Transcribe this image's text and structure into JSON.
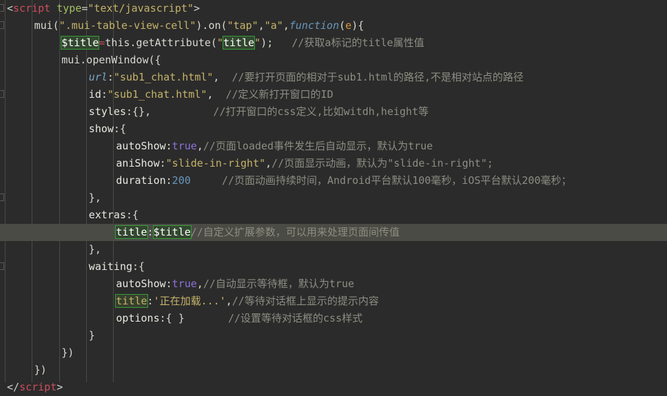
{
  "editor": {
    "name": "code-editor",
    "language": "html-javascript",
    "theme": "darcula",
    "colors": {
      "background": "#2b2b2b",
      "current_line": "#4b4b45",
      "indent_guide": "#4a4a48",
      "tag": "#cc4e5c",
      "attribute": "#a5c261",
      "string": "#c5b36a",
      "comment": "#8d8d83",
      "boolean": "#8d72d9",
      "number": "#6897bb",
      "keyword_function": "#6897bb",
      "parameter": "#d9963f",
      "field": "#7ba7c7",
      "search_highlight_border": "#3a9c3a",
      "search_highlight_fill": "#32472f",
      "default_text": "#d8d8d2"
    },
    "search_term": "title",
    "highlighted_line_index": 12,
    "fold_marker_lines": [
      0,
      1,
      5,
      11,
      15
    ],
    "indent_guide_x": [
      7,
      46,
      86,
      125,
      164
    ],
    "lines": [
      {
        "index": 0,
        "indent": 0,
        "tokens": [
          {
            "t": "<",
            "c": "punct"
          },
          {
            "t": "script",
            "c": "tag"
          },
          {
            "t": " ",
            "c": "plain"
          },
          {
            "t": "type",
            "c": "attr"
          },
          {
            "t": "=",
            "c": "punct"
          },
          {
            "t": "\"text/javascript\"",
            "c": "str"
          },
          {
            "t": ">",
            "c": "punct"
          }
        ]
      },
      {
        "index": 1,
        "indent": 1,
        "tokens": [
          {
            "t": "mui(",
            "c": "plain"
          },
          {
            "t": "\".mui-table-view-cell\"",
            "c": "str"
          },
          {
            "t": ").on(",
            "c": "plain"
          },
          {
            "t": "\"tap\"",
            "c": "str"
          },
          {
            "t": ",",
            "c": "plain"
          },
          {
            "t": "\"a\"",
            "c": "str"
          },
          {
            "t": ",",
            "c": "plain"
          },
          {
            "t": "function",
            "c": "kw-fn"
          },
          {
            "t": "(",
            "c": "plain"
          },
          {
            "t": "e",
            "c": "param"
          },
          {
            "t": "){",
            "c": "plain"
          }
        ]
      },
      {
        "index": 2,
        "indent": 2,
        "tokens": [
          {
            "t": "$title",
            "c": "plain",
            "hit": true
          },
          {
            "t": "=",
            "c": "op"
          },
          {
            "t": "this.getAttribute(",
            "c": "plain"
          },
          {
            "t": "\"",
            "c": "str"
          },
          {
            "t": "title",
            "c": "str",
            "hit": true
          },
          {
            "t": "\"",
            "c": "str"
          },
          {
            "t": ");",
            "c": "plain"
          },
          {
            "t": "   ",
            "c": "plain"
          },
          {
            "t": "//获取a标记的title属性值",
            "c": "comment"
          }
        ]
      },
      {
        "index": 3,
        "indent": 2,
        "tokens": [
          {
            "t": "mui.openWindow({",
            "c": "plain"
          }
        ]
      },
      {
        "index": 4,
        "indent": 3,
        "tokens": [
          {
            "t": "url",
            "c": "field"
          },
          {
            "t": ":",
            "c": "plain"
          },
          {
            "t": "\"sub1_chat.html\"",
            "c": "str"
          },
          {
            "t": ",  ",
            "c": "plain"
          },
          {
            "t": "//要打开页面的相对于sub1.html的路径,不是相对站点的路径",
            "c": "comment"
          }
        ]
      },
      {
        "index": 5,
        "indent": 3,
        "tokens": [
          {
            "t": "id",
            "c": "prop"
          },
          {
            "t": ":",
            "c": "plain"
          },
          {
            "t": "\"sub1_chat.html\"",
            "c": "str"
          },
          {
            "t": ",  ",
            "c": "plain"
          },
          {
            "t": "//定义新打开窗口的ID",
            "c": "comment"
          }
        ]
      },
      {
        "index": 6,
        "indent": 3,
        "tokens": [
          {
            "t": "styles",
            "c": "prop"
          },
          {
            "t": ":{},",
            "c": "plain"
          },
          {
            "t": "          ",
            "c": "plain"
          },
          {
            "t": "//打开窗口的css定义,比如witdh,height等",
            "c": "comment"
          }
        ]
      },
      {
        "index": 7,
        "indent": 3,
        "tokens": [
          {
            "t": "show",
            "c": "prop"
          },
          {
            "t": ":{",
            "c": "plain"
          }
        ]
      },
      {
        "index": 8,
        "indent": 4,
        "tokens": [
          {
            "t": "autoShow",
            "c": "prop"
          },
          {
            "t": ":",
            "c": "plain"
          },
          {
            "t": "true",
            "c": "bool"
          },
          {
            "t": ",",
            "c": "plain"
          },
          {
            "t": "//页面loaded事件发生后自动显示，默认为true",
            "c": "comment"
          }
        ]
      },
      {
        "index": 9,
        "indent": 4,
        "tokens": [
          {
            "t": "aniShow",
            "c": "prop"
          },
          {
            "t": ":",
            "c": "plain"
          },
          {
            "t": "\"slide-in-right\"",
            "c": "str"
          },
          {
            "t": ",",
            "c": "plain"
          },
          {
            "t": "//页面显示动画，默认为\"slide-in-right\";",
            "c": "comment"
          }
        ]
      },
      {
        "index": 10,
        "indent": 4,
        "tokens": [
          {
            "t": "duration",
            "c": "prop"
          },
          {
            "t": ":",
            "c": "plain"
          },
          {
            "t": "200",
            "c": "num"
          },
          {
            "t": "     ",
            "c": "plain"
          },
          {
            "t": "//页面动画持续时间，Android平台默认100毫秒，iOS平台默认200毫秒；",
            "c": "comment"
          }
        ]
      },
      {
        "index": 11,
        "indent": 3,
        "tokens": [
          {
            "t": "},",
            "c": "plain"
          }
        ]
      },
      {
        "index": 12,
        "indent": 3,
        "tokens": [
          {
            "t": "extras",
            "c": "prop"
          },
          {
            "t": ":{",
            "c": "plain"
          }
        ]
      },
      {
        "index": 13,
        "indent": 4,
        "highlighted": true,
        "tokens": [
          {
            "t": "title",
            "c": "plain",
            "hit": true
          },
          {
            "t": ":",
            "c": "plain"
          },
          {
            "t": "$title",
            "c": "plain",
            "hit": true
          },
          {
            "t": "//自定义扩展参数，可以用来处理页面间传值",
            "c": "comment"
          }
        ]
      },
      {
        "index": 14,
        "indent": 3,
        "tokens": [
          {
            "t": "},",
            "c": "plain"
          }
        ]
      },
      {
        "index": 15,
        "indent": 3,
        "tokens": [
          {
            "t": "waiting",
            "c": "prop"
          },
          {
            "t": ":{",
            "c": "plain"
          }
        ]
      },
      {
        "index": 16,
        "indent": 4,
        "tokens": [
          {
            "t": "autoShow",
            "c": "prop"
          },
          {
            "t": ":",
            "c": "plain"
          },
          {
            "t": "true",
            "c": "bool"
          },
          {
            "t": ",",
            "c": "plain"
          },
          {
            "t": "//自动显示等待框，默认为true",
            "c": "comment"
          }
        ]
      },
      {
        "index": 17,
        "indent": 4,
        "tokens": [
          {
            "t": "title",
            "c": "str",
            "hitdim": true
          },
          {
            "t": ":",
            "c": "plain"
          },
          {
            "t": "'正在加载...'",
            "c": "str"
          },
          {
            "t": ",",
            "c": "plain"
          },
          {
            "t": "//等待对话框上显示的提示内容",
            "c": "comment"
          }
        ]
      },
      {
        "index": 18,
        "indent": 4,
        "tokens": [
          {
            "t": "options",
            "c": "prop"
          },
          {
            "t": ":{ }",
            "c": "plain"
          },
          {
            "t": "       ",
            "c": "plain"
          },
          {
            "t": "//设置等待对话框的css样式",
            "c": "comment"
          }
        ]
      },
      {
        "index": 19,
        "indent": 3,
        "tokens": [
          {
            "t": "}",
            "c": "plain"
          }
        ]
      },
      {
        "index": 20,
        "indent": 2,
        "tokens": [
          {
            "t": "})",
            "c": "plain"
          }
        ]
      },
      {
        "index": 21,
        "indent": 1,
        "tokens": [
          {
            "t": "})",
            "c": "plain"
          }
        ]
      },
      {
        "index": 22,
        "indent": 0,
        "tokens": [
          {
            "t": "</",
            "c": "punct"
          },
          {
            "t": "script",
            "c": "tag"
          },
          {
            "t": ">",
            "c": "punct"
          }
        ]
      }
    ]
  }
}
